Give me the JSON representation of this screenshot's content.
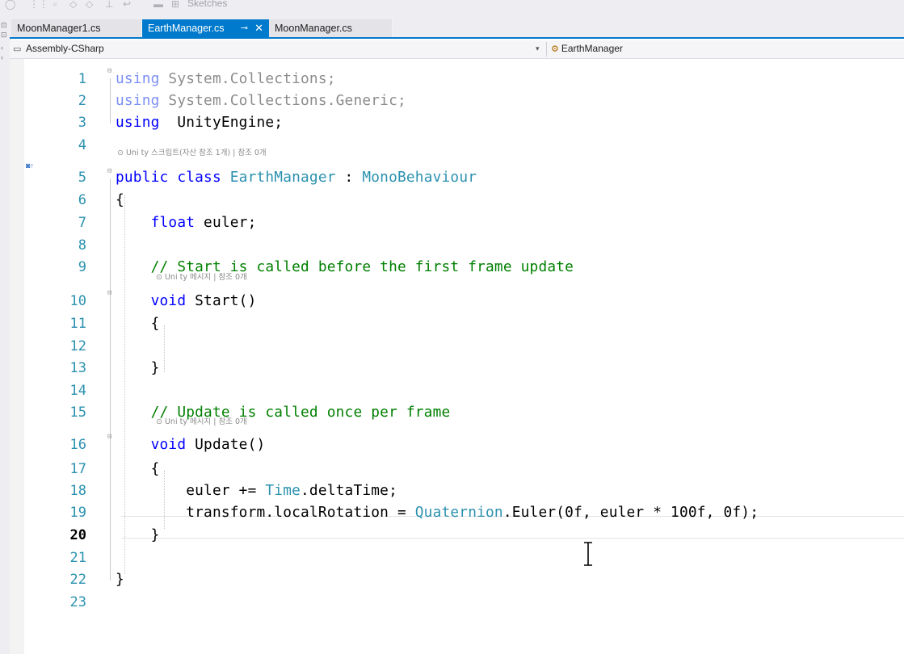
{
  "toolbar": {
    "partial_label": "Sketches"
  },
  "tabs": [
    {
      "label": "MoonManager1.cs",
      "active": false
    },
    {
      "label": "EarthManager.cs",
      "active": true,
      "pin_icon": "pin-icon",
      "close_icon": "close-icon"
    },
    {
      "label": "MoonManager.cs",
      "active": false
    }
  ],
  "navbar": {
    "project": "Assembly-CSharp",
    "class_name": "EarthManager"
  },
  "editor": {
    "current_line": 20,
    "lens": {
      "class": "⊙ Uni ty 스크립트(자산 참조 1개) | 참조 0개",
      "start": "⊙ Uni ty 메시지 | 참조 0개",
      "update": "⊙ Uni ty 메시지 | 참조 0개"
    },
    "lines": [
      {
        "n": "1",
        "tokens": [
          [
            "kw-dim",
            "using"
          ],
          [
            "dim",
            " System.Collections;"
          ]
        ]
      },
      {
        "n": "2",
        "tokens": [
          [
            "kw-dim",
            "using"
          ],
          [
            "dim",
            " System.Collections.Generic;"
          ]
        ]
      },
      {
        "n": "3",
        "tokens": [
          [
            "kw",
            "using"
          ],
          [
            "",
            "  UnityEngine;"
          ]
        ]
      },
      {
        "n": "4",
        "tokens": []
      },
      {
        "n": "5",
        "tokens": [
          [
            "kw",
            "public"
          ],
          [
            "",
            " "
          ],
          [
            "kw",
            "class"
          ],
          [
            "",
            " "
          ],
          [
            "type",
            "EarthManager"
          ],
          [
            "",
            " : "
          ],
          [
            "type",
            "MonoBehaviour"
          ]
        ]
      },
      {
        "n": "6",
        "tokens": [
          [
            "",
            "{"
          ]
        ]
      },
      {
        "n": "7",
        "tokens": [
          [
            "",
            "    "
          ],
          [
            "kw",
            "float"
          ],
          [
            "",
            " euler;"
          ]
        ]
      },
      {
        "n": "8",
        "tokens": []
      },
      {
        "n": "9",
        "tokens": [
          [
            "",
            "    "
          ],
          [
            "cm",
            "// Start is called before the first frame update"
          ]
        ]
      },
      {
        "n": "10",
        "tokens": [
          [
            "",
            "    "
          ],
          [
            "kw",
            "void"
          ],
          [
            "",
            " Start()"
          ]
        ]
      },
      {
        "n": "11",
        "tokens": [
          [
            "",
            "    {"
          ]
        ]
      },
      {
        "n": "12",
        "tokens": []
      },
      {
        "n": "13",
        "tokens": [
          [
            "",
            "    }"
          ]
        ]
      },
      {
        "n": "14",
        "tokens": []
      },
      {
        "n": "15",
        "tokens": [
          [
            "",
            "    "
          ],
          [
            "cm",
            "// Update is called once per frame"
          ]
        ]
      },
      {
        "n": "16",
        "tokens": [
          [
            "",
            "    "
          ],
          [
            "kw",
            "void"
          ],
          [
            "",
            " Update()"
          ]
        ]
      },
      {
        "n": "17",
        "tokens": [
          [
            "",
            "    {"
          ]
        ]
      },
      {
        "n": "18",
        "tokens": [
          [
            "",
            "        euler += "
          ],
          [
            "type",
            "Time"
          ],
          [
            "",
            ".deltaTime;"
          ]
        ]
      },
      {
        "n": "19",
        "tokens": [
          [
            "",
            "        transform.localRotation = "
          ],
          [
            "type",
            "Quaternion"
          ],
          [
            "",
            ".Euler(0f, euler * 100f, 0f);"
          ]
        ]
      },
      {
        "n": "20",
        "tokens": [
          [
            "",
            "    }"
          ]
        ]
      },
      {
        "n": "21",
        "tokens": []
      },
      {
        "n": "22",
        "tokens": [
          [
            "",
            "}"
          ]
        ]
      },
      {
        "n": "23",
        "tokens": []
      }
    ]
  }
}
